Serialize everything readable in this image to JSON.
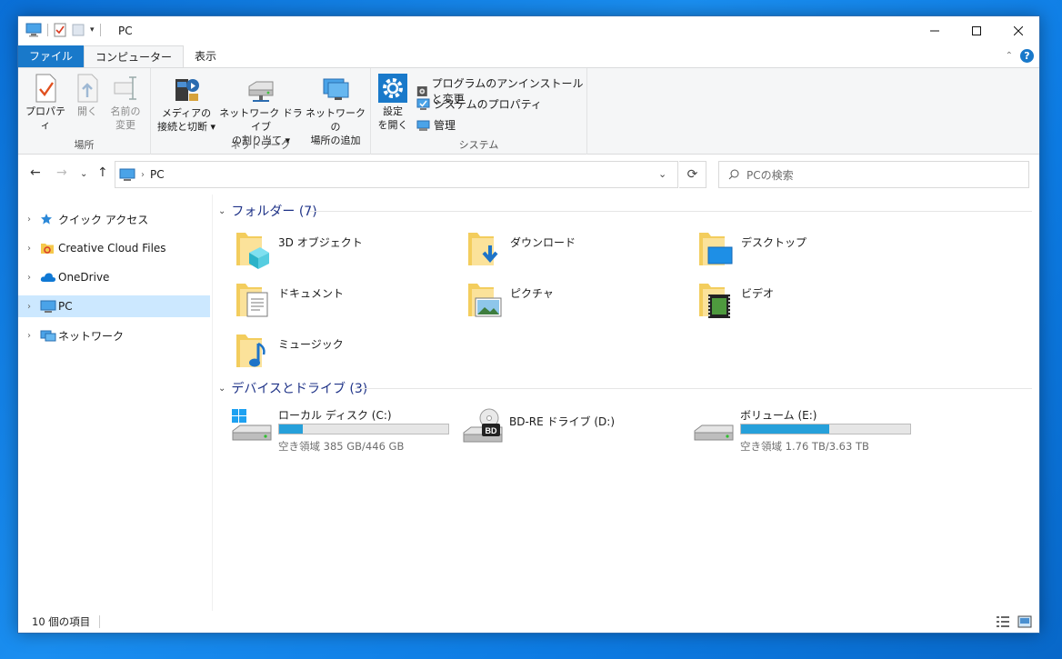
{
  "window": {
    "title": "PC"
  },
  "tabs": {
    "file": "ファイル",
    "computer": "コンピューター",
    "view": "表示"
  },
  "ribbon": {
    "location_group": "場所",
    "network_group": "ネットワーク",
    "system_group": "システム",
    "properties": "プロパティ",
    "open": "開く",
    "rename_1": "名前の",
    "rename_2": "変更",
    "media_1": "メディアの",
    "media_2": "接続と切断",
    "map_drive_1": "ネットワーク ドライブ",
    "map_drive_2": "の割り当て",
    "add_location_1": "ネットワークの",
    "add_location_2": "場所の追加",
    "settings_1": "設定",
    "settings_2": "を開く",
    "uninstall": "プログラムのアンインストールと変更",
    "system_props": "システムのプロパティ",
    "manage": "管理"
  },
  "address": {
    "crumb": "PC",
    "search_placeholder": "PCの検索"
  },
  "nav": {
    "quick_access": "クイック アクセス",
    "creative_cloud": "Creative Cloud Files",
    "onedrive": "OneDrive",
    "pc": "PC",
    "network": "ネットワーク"
  },
  "folders": {
    "header": "フォルダー (7)",
    "items": [
      "3D オブジェクト",
      "ダウンロード",
      "デスクトップ",
      "ドキュメント",
      "ピクチャ",
      "ビデオ",
      "ミュージック"
    ]
  },
  "drives": {
    "header": "デバイスとドライブ (3)",
    "items": [
      {
        "name": "ローカル ディスク (C:)",
        "free": "空き領域 385 GB/446 GB",
        "used_fraction": 0.14
      },
      {
        "name": "BD-RE ドライブ (D:)"
      },
      {
        "name": "ボリューム (E:)",
        "free": "空き領域 1.76 TB/3.63 TB",
        "used_fraction": 0.52
      }
    ]
  },
  "status": {
    "count": "10 個の項目"
  },
  "colors": {
    "accent": "#1979ca",
    "selection": "#cce8ff",
    "bar_fill": "#26a0da",
    "section_header": "#1e3287"
  }
}
